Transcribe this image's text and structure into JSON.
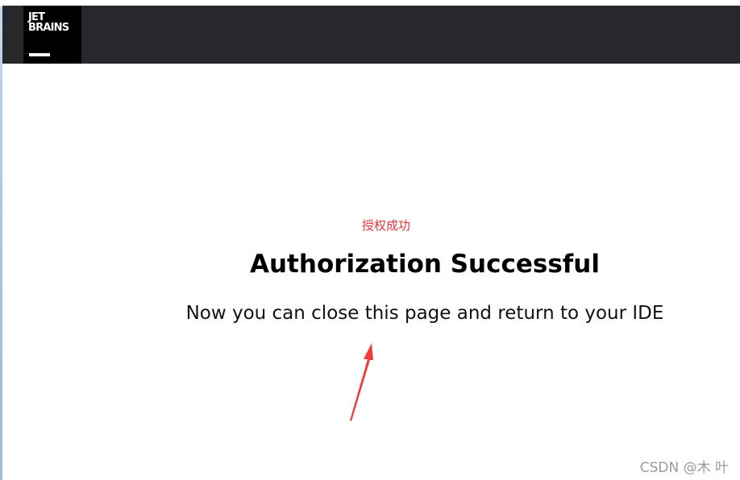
{
  "header": {
    "logo": {
      "line1": "JET",
      "line2": "BRAINS"
    }
  },
  "main": {
    "annotation": "授权成功",
    "title": "Authorization Successful",
    "message": "Now you can close this page and return to your IDE"
  },
  "watermark": "CSDN @木 叶",
  "colors": {
    "topbar": "#27282c",
    "logo_background": "#000000",
    "annotation": "#e6373d",
    "arrow": "#f03c3c"
  }
}
